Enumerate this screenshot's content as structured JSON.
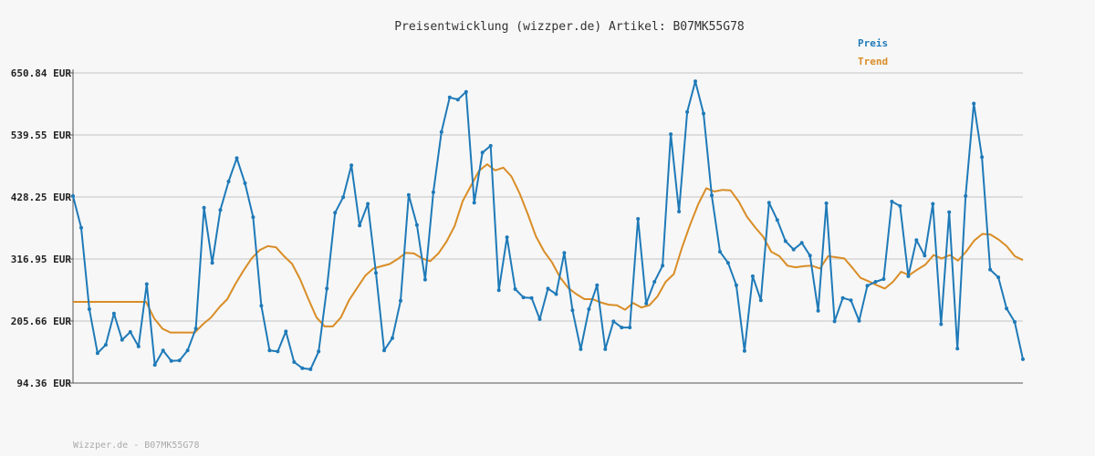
{
  "chart_data": {
    "type": "line",
    "title": "Preisentwicklung (wizzper.de) Artikel: B07MK55G78",
    "footer": "Wizzper.de - B07MK55G78",
    "ylim": [
      94.36,
      650.84
    ],
    "yticks": [
      94.36,
      205.66,
      316.95,
      428.25,
      539.55,
      650.84
    ],
    "ytick_labels": [
      "94.36 EUR",
      "205.66 EUR",
      "316.95 EUR",
      "428.25 EUR",
      "539.55 EUR",
      "650.84 EUR"
    ],
    "grid": true,
    "legend_position": "top-right",
    "colors": {
      "preis": "#1f7ab8",
      "trend": "#d98d26",
      "grid": "#dddddd",
      "axis": "#555555"
    },
    "series": [
      {
        "name": "Preis",
        "values": [
          430,
          373,
          227,
          148,
          163,
          219,
          172,
          186,
          160,
          272,
          127,
          153,
          134,
          135,
          153,
          192,
          409,
          310,
          405,
          456,
          498,
          453,
          392,
          233,
          153,
          151,
          187,
          132,
          121,
          119,
          151,
          264,
          400,
          428,
          485,
          377,
          416,
          292,
          153,
          175,
          242,
          432,
          378,
          280,
          437,
          545,
          607,
          603,
          617,
          418,
          508,
          520,
          261,
          356,
          263,
          248,
          247,
          209,
          264,
          254,
          328,
          225,
          155,
          227,
          270,
          155,
          205,
          194,
          194,
          389,
          237,
          276,
          305,
          541,
          402,
          581,
          636,
          578,
          431,
          330,
          310,
          270,
          152,
          286,
          243,
          418,
          387,
          349,
          334,
          346,
          323,
          224,
          417,
          205,
          247,
          243,
          206,
          269,
          276,
          281,
          420,
          412,
          286,
          351,
          323,
          416,
          200,
          401,
          156,
          430,
          596,
          500,
          298,
          284,
          228,
          204,
          137
        ]
      },
      {
        "name": "Trend",
        "values": [
          240,
          240,
          240,
          240,
          240,
          240,
          240,
          240,
          240,
          240,
          210,
          192,
          185,
          185,
          185,
          185,
          200,
          212,
          230,
          245,
          272,
          296,
          318,
          333,
          340,
          338,
          322,
          308,
          280,
          245,
          212,
          196,
          196,
          212,
          243,
          265,
          287,
          300,
          304,
          308,
          317,
          328,
          327,
          318,
          313,
          327,
          348,
          376,
          421,
          448,
          475,
          487,
          476,
          481,
          465,
          435,
          398,
          358,
          331,
          311,
          284,
          265,
          254,
          245,
          245,
          239,
          235,
          234,
          226,
          238,
          230,
          234,
          250,
          276,
          290,
          337,
          378,
          415,
          444,
          438,
          441,
          440,
          420,
          393,
          374,
          357,
          330,
          322,
          305,
          302,
          304,
          305,
          300,
          322,
          320,
          318,
          301,
          283,
          277,
          270,
          264,
          276,
          294,
          288,
          298,
          307,
          324,
          318,
          324,
          314,
          330,
          350,
          362,
          361,
          352,
          340,
          322,
          315
        ]
      }
    ]
  }
}
